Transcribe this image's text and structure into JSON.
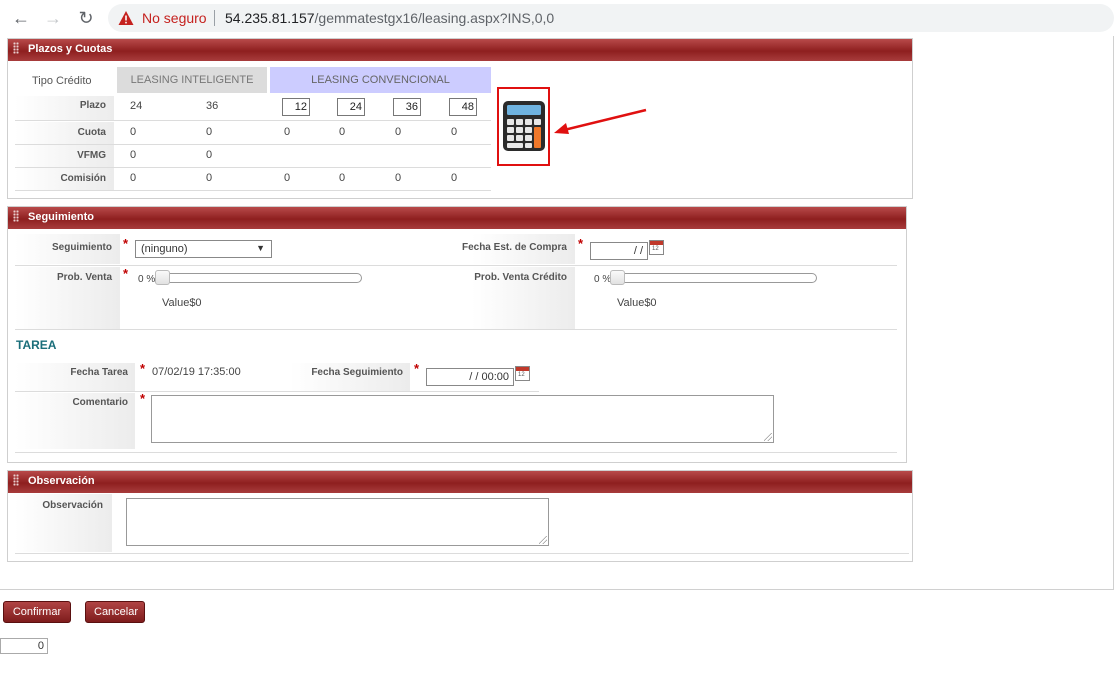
{
  "browser": {
    "warning_text": "No seguro",
    "url_host": "54.235.81.157",
    "url_path": "/gemmatestgx16/leasing.aspx?INS,0,0"
  },
  "plazos": {
    "header": "Plazos y Cuotas",
    "tipo_credito_label": "Tipo Crédito",
    "col_inteligente": "LEASING INTELIGENTE",
    "col_convencional": "LEASING CONVENCIONAL",
    "row_labels": {
      "plazo": "Plazo",
      "cuota": "Cuota",
      "vfmg": "VFMG",
      "comision": "Comisión"
    },
    "intel_plazo": [
      "24",
      "36"
    ],
    "intel_cuota": [
      "0",
      "0"
    ],
    "intel_vfmg": [
      "0",
      "0"
    ],
    "intel_comision": [
      "0",
      "0"
    ],
    "conv_plazo": [
      "12",
      "24",
      "36",
      "48"
    ],
    "conv_cuota": [
      "0",
      "0",
      "0",
      "0"
    ],
    "conv_comision": [
      "0",
      "0",
      "0",
      "0"
    ]
  },
  "seguimiento": {
    "header": "Seguimiento",
    "seguimiento_label": "Seguimiento",
    "seguimiento_value": "(ninguno)",
    "fecha_compra_label": "Fecha Est. de Compra",
    "fecha_compra_value": "/ /",
    "prob_venta_label": "Prob. Venta",
    "prob_venta_pct": "0 %",
    "prob_venta_value_text": "Value$0",
    "prob_venta_credito_label": "Prob. Venta Crédito",
    "prob_venta_credito_pct": "0 %",
    "prob_venta_credito_value_text": "Value$0",
    "slider_level": 0
  },
  "tarea": {
    "title": "TAREA",
    "fecha_tarea_label": "Fecha Tarea",
    "fecha_tarea_value": "07/02/19 17:35:00",
    "fecha_seguimiento_label": "Fecha Seguimiento",
    "fecha_seguimiento_value": "/ /  00:00",
    "comentario_label": "Comentario"
  },
  "observacion": {
    "header": "Observación",
    "label": "Observación"
  },
  "actions": {
    "confirm": "Confirmar",
    "cancel": "Cancelar"
  },
  "counter_value": "0",
  "colors": {
    "panel_header": "#9b2c2c",
    "required": "#c00000",
    "convencional_bg": "#ccccff",
    "inteligente_bg": "#dcdcdc"
  }
}
